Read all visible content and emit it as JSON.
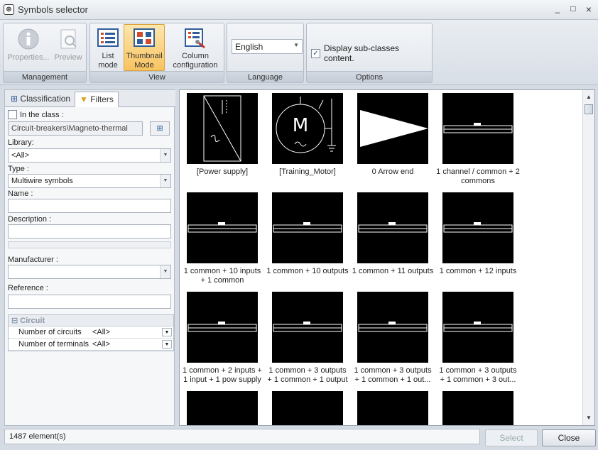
{
  "window": {
    "title": "Symbols selector",
    "minimize": "_",
    "maximize": "□",
    "close": "×"
  },
  "ribbon": {
    "management": {
      "caption": "Management",
      "properties": "Properties...",
      "preview": "Preview"
    },
    "view": {
      "caption": "View",
      "list_line1": "List",
      "list_line2": "mode",
      "thumb_line1": "Thumbnail",
      "thumb_line2": "Mode",
      "col_line1": "Column",
      "col_line2": "configuration"
    },
    "language": {
      "caption": "Language",
      "value": "English"
    },
    "options": {
      "caption": "Options",
      "subclasses_label": "Display sub-classes content.",
      "subclasses_checked": "✓"
    }
  },
  "left": {
    "tabs": {
      "classification": "Classification",
      "filters": "Filters"
    },
    "in_class_label": "In the class :",
    "class_value": "Circuit-breakers\\Magneto-thermal",
    "library_label": "Library:",
    "library_value": "<All>",
    "type_label": "Type :",
    "type_value": "Multiwire symbols",
    "name_label": "Name :",
    "description_label": "Description :",
    "manufacturer_label": "Manufacturer :",
    "reference_label": "Reference :",
    "circuit": {
      "header": "Circuit",
      "rows": [
        {
          "name": "Number of circuits",
          "value": "<All>"
        },
        {
          "name": "Number of terminals",
          "value": "<All>"
        }
      ]
    }
  },
  "thumbnails": [
    {
      "l1": "[Power supply]",
      "l2": ""
    },
    {
      "l1": "[Training_Motor]",
      "l2": ""
    },
    {
      "l1": "0 Arrow end",
      "l2": ""
    },
    {
      "l1": "1 channel / common + 2",
      "l2": "commons"
    },
    {
      "l1": "1 common + 10 inputs",
      "l2": "+ 1 common"
    },
    {
      "l1": "1 common + 10 outputs",
      "l2": ""
    },
    {
      "l1": "1 common + 11 outputs",
      "l2": ""
    },
    {
      "l1": "1 common + 12 inputs",
      "l2": ""
    },
    {
      "l1": "1 common + 2 inputs +",
      "l2": "1 input + 1 pow supply"
    },
    {
      "l1": "1 common + 3 outputs",
      "l2": "+ 1 common + 1 output"
    },
    {
      "l1": "1 common + 3 outputs",
      "l2": "+ 1 common + 1 out..."
    },
    {
      "l1": "1 common + 3 outputs",
      "l2": "+ 1 common + 3 out..."
    },
    {
      "l1": "",
      "l2": ""
    },
    {
      "l1": "",
      "l2": ""
    },
    {
      "l1": "",
      "l2": ""
    },
    {
      "l1": "",
      "l2": ""
    }
  ],
  "status": {
    "count": "1487 element(s)"
  },
  "buttons": {
    "select": "Select",
    "close": "Close"
  }
}
